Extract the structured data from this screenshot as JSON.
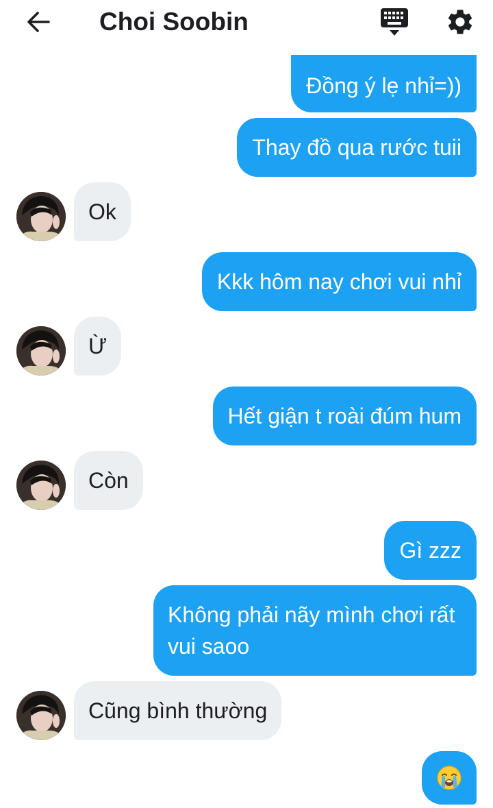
{
  "header": {
    "title": "Choi Soobin",
    "back_icon": "arrow-left-icon",
    "keyboard_icon": "keyboard-icon",
    "settings_icon": "gear-icon"
  },
  "colors": {
    "sent_bubble": "#1da1f2",
    "received_bubble": "#eceff1",
    "text_dark": "#1c1e21"
  },
  "messages": [
    {
      "from": "me",
      "text": "Đồng ý lẹ nhỉ=))"
    },
    {
      "from": "me",
      "text": "Thay đồ qua rước tuii"
    },
    {
      "from": "them",
      "text": "Ok"
    },
    {
      "from": "me",
      "text": "Kkk hôm nay chơi vui nhỉ"
    },
    {
      "from": "them",
      "text": "Ừ"
    },
    {
      "from": "me",
      "text": "Hết giận t roài đúm hum"
    },
    {
      "from": "them",
      "text": "Còn"
    },
    {
      "from": "me",
      "text": "Gì zzz"
    },
    {
      "from": "me",
      "text": "Không phải nãy mình chơi rất vui saoo"
    },
    {
      "from": "them",
      "text": "Cũng bình thường"
    },
    {
      "from": "me",
      "emoji": "loudly-crying-face-emoji"
    }
  ]
}
